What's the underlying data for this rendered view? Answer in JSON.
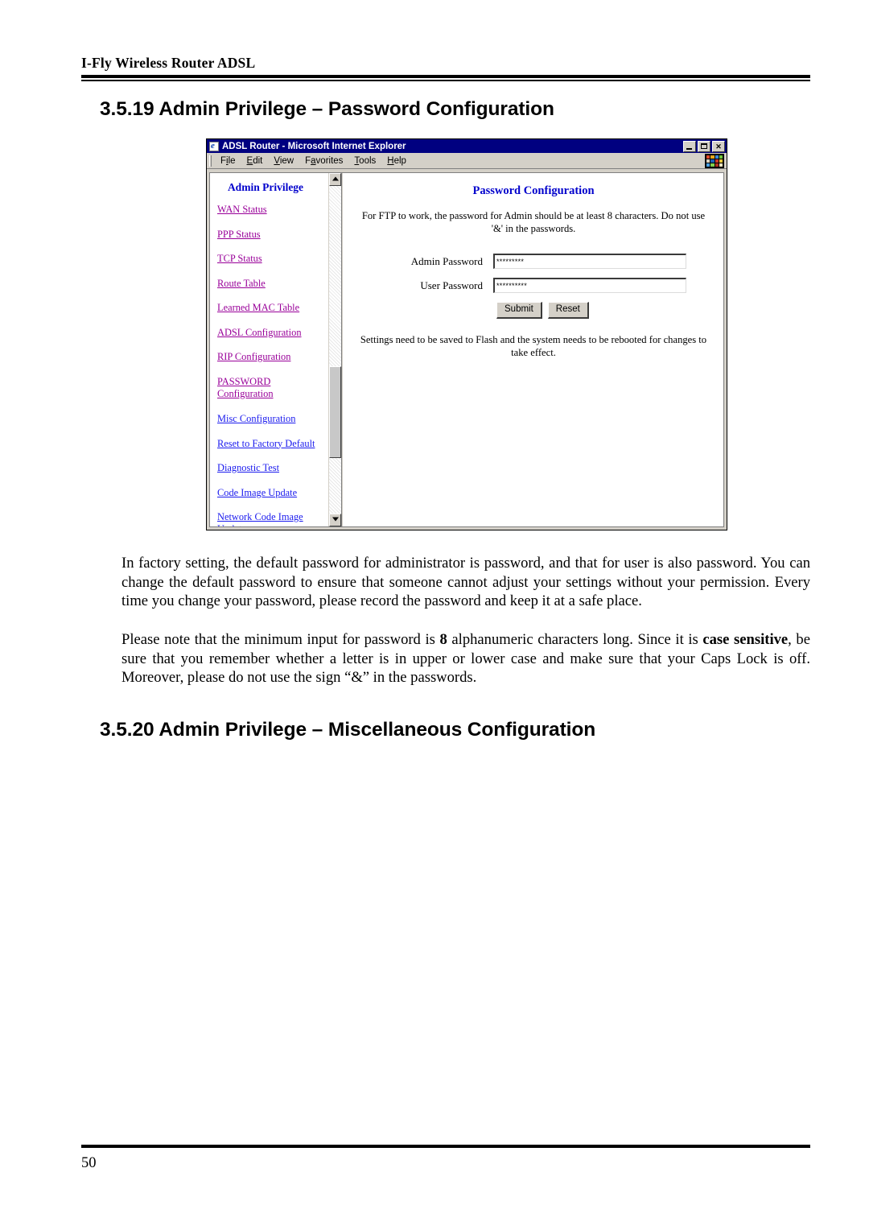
{
  "document": {
    "running_header": "I-Fly Wireless Router ADSL",
    "page_number": "50",
    "headings": {
      "section_3519": "3.5.19 Admin Privilege – Password Configuration",
      "section_3520": "3.5.20 Admin Privilege – Miscellaneous Configuration"
    },
    "paragraph_1": "In factory setting, the default password for administrator is password, and that for user is also password. You can change the default password to ensure that someone cannot adjust your settings without your permission. Every time you change your password, please record the password and keep it at a safe place.",
    "paragraph_2": {
      "part_1": "Please note that the minimum input for password is ",
      "bold_1": "8",
      "part_2": " alphanumeric characters long. Since it is ",
      "bold_2": "case sensitive",
      "part_3": ", be sure that you remember whether a letter is in upper or lower case and make sure that your Caps Lock is off. Moreover, please do not use the sign “&” in the passwords."
    }
  },
  "browser": {
    "title": "ADSL Router - Microsoft Internet Explorer",
    "title_icon": "ie-document-icon",
    "window_buttons": [
      {
        "name": "minimize-button",
        "glyph": ""
      },
      {
        "name": "restore-button",
        "glyph": ""
      },
      {
        "name": "close-button",
        "glyph": "✕"
      }
    ],
    "menu_items": [
      {
        "name": "menu-file",
        "pre": "F",
        "accel": "i",
        "post": "le"
      },
      {
        "name": "menu-edit",
        "pre": "",
        "accel": "E",
        "post": "dit"
      },
      {
        "name": "menu-view",
        "pre": "",
        "accel": "V",
        "post": "iew"
      },
      {
        "name": "menu-favorites",
        "pre": "F",
        "accel": "a",
        "post": "vorites"
      },
      {
        "name": "menu-tools",
        "pre": "",
        "accel": "T",
        "post": "ools"
      },
      {
        "name": "menu-help",
        "pre": "",
        "accel": "H",
        "post": "elp"
      }
    ],
    "logo_colors": [
      "#e04a2a",
      "#e8a61c",
      "#3a8ad8",
      "#6fc43c",
      "#d8d0c0",
      "#1a5fb4",
      "#c8382a",
      "#e8c83c",
      "#4aa0e0",
      "#80d050",
      "#b03020",
      "#f0e4c0"
    ]
  },
  "nav_frame": {
    "title": "Admin Privilege",
    "links": [
      {
        "label": "WAN Status",
        "state": "visited"
      },
      {
        "label": "PPP Status",
        "state": "visited"
      },
      {
        "label": "TCP Status",
        "state": "visited"
      },
      {
        "label": "Route Table",
        "state": "visited"
      },
      {
        "label": "Learned MAC Table",
        "state": "visited"
      },
      {
        "label": "ADSL Configuration",
        "state": "visited"
      },
      {
        "label": "RIP Configuration",
        "state": "visited"
      },
      {
        "label": "PASSWORD Configuration",
        "state": "visited"
      },
      {
        "label": "Misc Configuration",
        "state": "unvisited"
      },
      {
        "label": "Reset to Factory Default",
        "state": "unvisited"
      },
      {
        "label": "Diagnostic Test",
        "state": "unvisited"
      },
      {
        "label": "Code Image Update",
        "state": "unvisited"
      },
      {
        "label": "Network Code Image Update",
        "state": "unvisited"
      }
    ],
    "scrollbar": {
      "up_arrow": "scroll-up-arrow-icon",
      "down_arrow": "scroll-down-arrow-icon"
    }
  },
  "content_frame": {
    "title": "Password Configuration",
    "note": "For FTP to work, the password for Admin should be at least 8 characters. Do not use '&' in the passwords.",
    "fields": [
      {
        "label": "Admin Password",
        "value": "*********",
        "placeholder": ""
      },
      {
        "label": "User Password",
        "value": "**********",
        "placeholder": ""
      }
    ],
    "buttons": [
      {
        "label": "Submit"
      },
      {
        "label": "Reset"
      }
    ],
    "footnote": "Settings need to be saved to Flash and the system needs to be rebooted for changes to take effect."
  },
  "colors": {
    "link_visited": "#990099",
    "link_unvisited": "#1a1aee",
    "heading_blue": "#0000cc",
    "titlebar": "#000080",
    "chrome": "#d4d0c8"
  }
}
